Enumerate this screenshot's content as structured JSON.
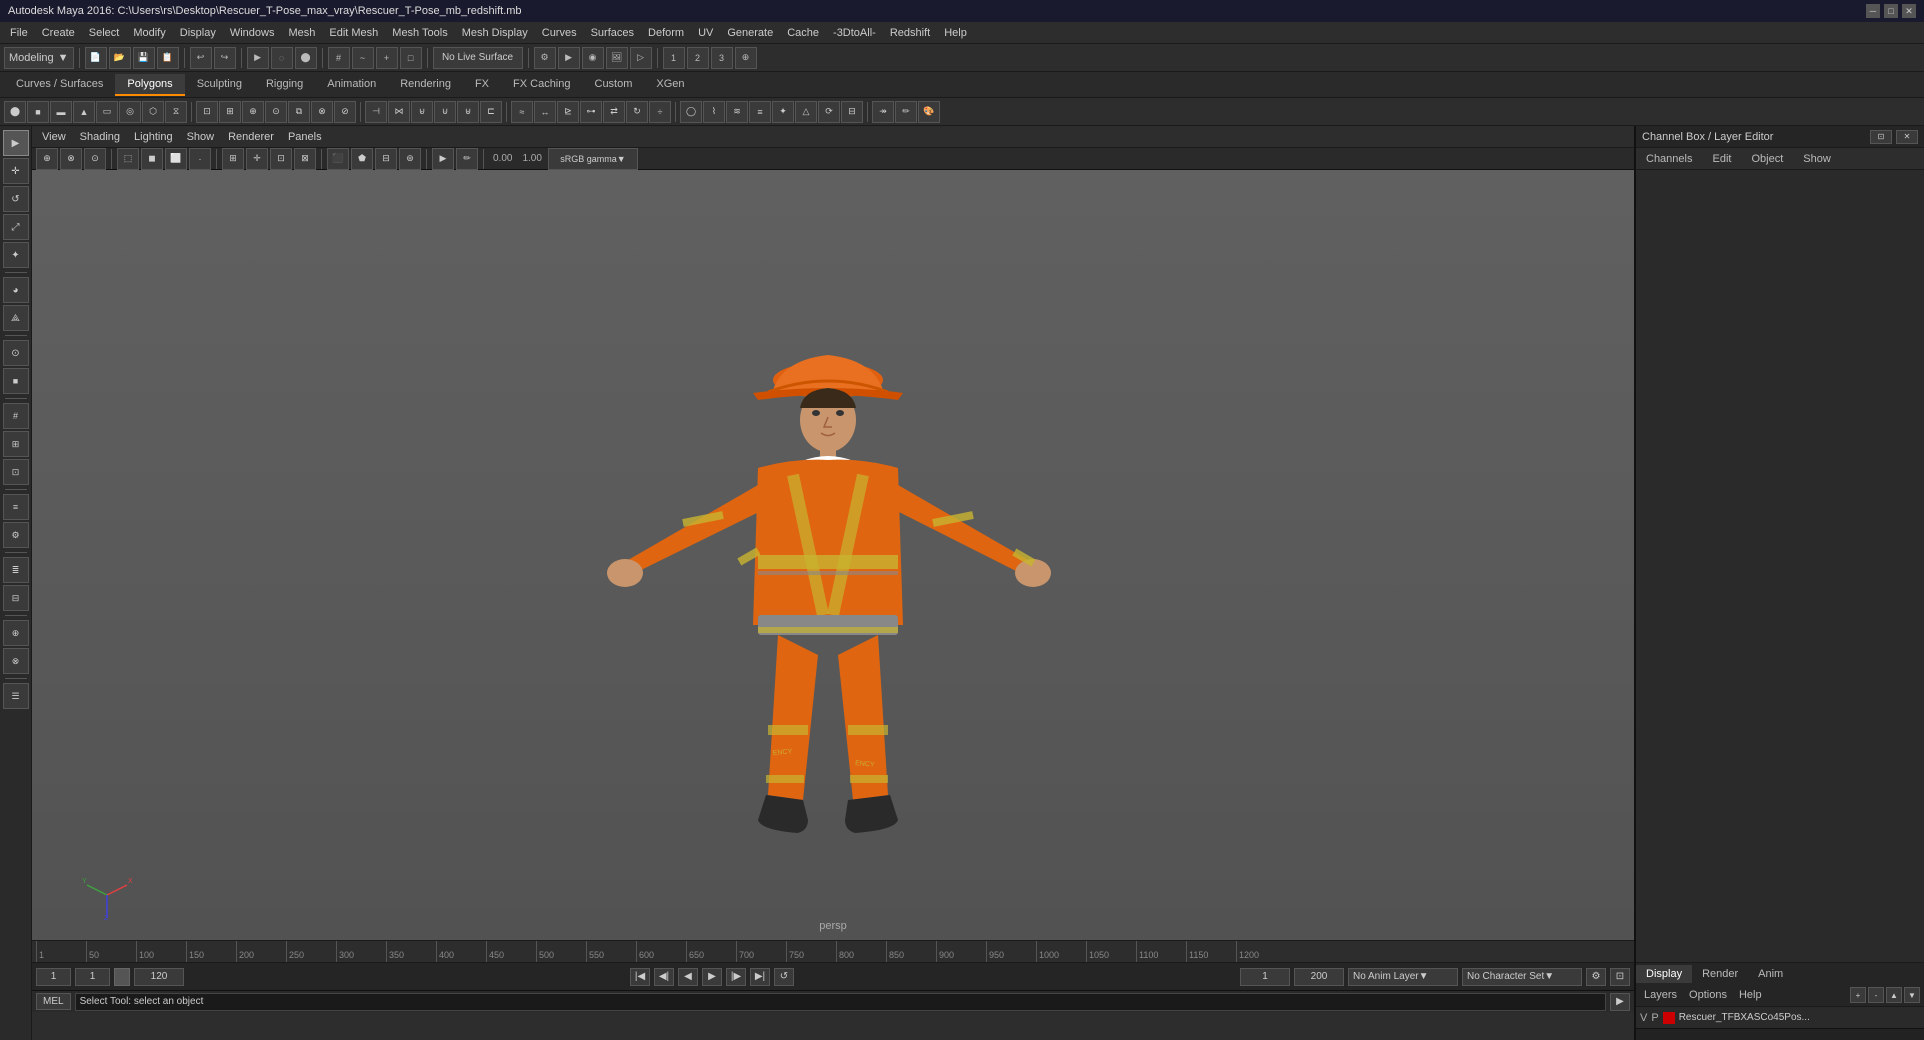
{
  "app": {
    "title": "Autodesk Maya 2016: C:\\Users\\rs\\Desktop\\Rescuer_T-Pose_max_vray\\Rescuer_T-Pose_mb_redshift.mb",
    "window_controls": [
      "─",
      "□",
      "✕"
    ]
  },
  "menu_bar": {
    "items": [
      "File",
      "Create",
      "Select",
      "Modify",
      "Display",
      "Windows",
      "Mesh",
      "Edit Mesh",
      "Mesh Tools",
      "Mesh Display",
      "Curves",
      "Surfaces",
      "Deform",
      "UV",
      "Generate",
      "Cache",
      "-3DtoAll-",
      "Redshift",
      "Help"
    ]
  },
  "toolbar1": {
    "mode_dropdown": "Modeling",
    "no_live_surface": "No Live Surface"
  },
  "tabs": {
    "items": [
      "Curves / Surfaces",
      "Polygons",
      "Sculpting",
      "Rigging",
      "Animation",
      "Rendering",
      "FX",
      "FX Caching",
      "Custom",
      "XGen"
    ],
    "active": "Polygons"
  },
  "view_toolbar": {
    "items": [
      "View",
      "Shading",
      "Lighting",
      "Show",
      "Renderer",
      "Panels"
    ]
  },
  "viewport": {
    "label": "persp",
    "camera_values": [
      "0.00",
      "1.00"
    ],
    "gamma": "sRGB gamma"
  },
  "right_panel": {
    "title": "Channel Box / Layer Editor",
    "channel_tabs": [
      "Channels",
      "Edit",
      "Object",
      "Show"
    ],
    "bottom_tabs": [
      "Display",
      "Render",
      "Anim"
    ],
    "active_bottom_tab": "Display",
    "layers_menu": [
      "Layers",
      "Options",
      "Help"
    ],
    "layer_row": {
      "v": "V",
      "p": "P",
      "name": "Rescuer_TFBXASCo45Pos..."
    }
  },
  "timeline": {
    "ruler_marks": [
      "1",
      "50",
      "100",
      "150",
      "200",
      "250",
      "300",
      "350",
      "400",
      "450",
      "500",
      "550",
      "600",
      "650",
      "700",
      "750",
      "800",
      "850",
      "900",
      "950",
      "1000",
      "1050",
      "1100",
      "1150",
      "1200"
    ],
    "current_frame": "1",
    "start_frame": "1",
    "end_frame": "120",
    "anim_start": "1",
    "anim_end": "200",
    "no_anim_layer": "No Anim Layer",
    "no_character_set": "No Character Set"
  },
  "mel_bar": {
    "label": "MEL",
    "status": "Select Tool: select an object"
  },
  "icons": {
    "select": "▶",
    "move": "✛",
    "rotate": "↺",
    "scale": "⤢",
    "play_back": "◀◀",
    "play_back_step": "◀",
    "play_back_play": "◀",
    "play_fwd": "▶",
    "play_fwd_step": "▶",
    "play_fwd_play": "▶▶",
    "play_end": "▶|"
  }
}
